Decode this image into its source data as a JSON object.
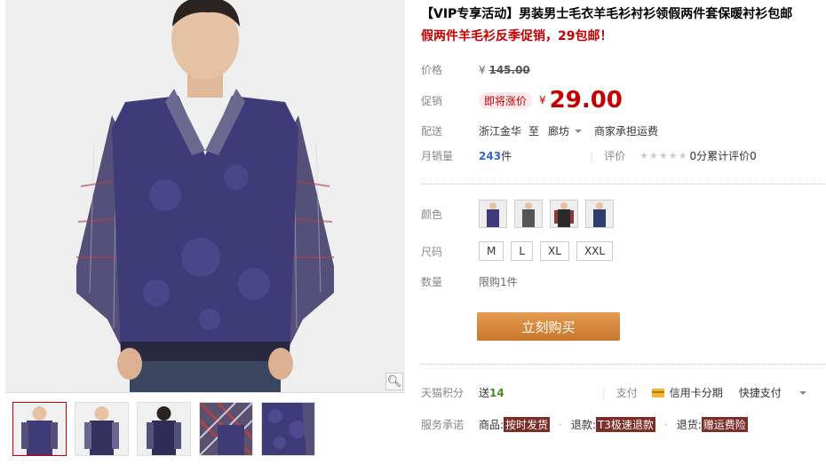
{
  "product": {
    "title": "【VIP专享活动】男装男士毛衣羊毛衫衬衫领假两件套保暖衬衫包邮",
    "subtitle": "假两件羊毛衫反季促销，29包邮！"
  },
  "price": {
    "label": "价格",
    "symbol": "¥",
    "original": "145.00"
  },
  "promo": {
    "label": "促销",
    "badge": "即将涨价",
    "symbol": "¥",
    "price": "29.00"
  },
  "shipping": {
    "label": "配送",
    "from": "浙江金华",
    "to_word": "至",
    "destination": "廊坊",
    "note": "商家承担运费"
  },
  "sales": {
    "label": "月销量",
    "count": "243",
    "unit": "件",
    "review_label": "评价",
    "stars": "★★★★★",
    "review_text": "0分累计评价0"
  },
  "options": {
    "color_label": "颜色",
    "size_label": "尺码",
    "sizes": [
      "M",
      "L",
      "XL",
      "XXL"
    ],
    "qty_label": "数量",
    "qty_limit": "限购1件"
  },
  "buy_button": "立刻购买",
  "points": {
    "label": "天猫积分",
    "prefix": "送",
    "value": "14",
    "pay_label": "支付",
    "card_text": "信用卡分期",
    "quick_pay": "快捷支付"
  },
  "service": {
    "label": "服务承诺",
    "item1_prefix": "商品:",
    "item1": "按时发货",
    "item2_prefix": "退款:",
    "item2": "T3极速退款",
    "item3_prefix": "退货:",
    "item3": "赠运费险"
  },
  "icons": {
    "zoom": "magnifier-icon",
    "star": "star-icon"
  }
}
